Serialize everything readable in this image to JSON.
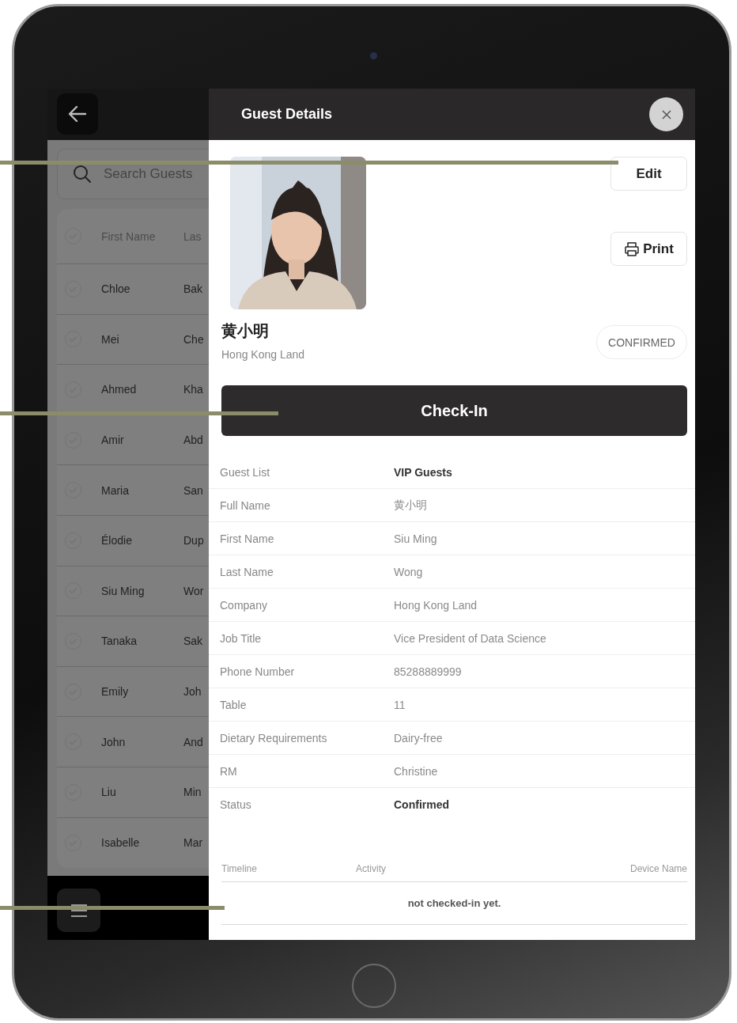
{
  "sidebar": {
    "search": {
      "placeholder": "Search Guests"
    },
    "table": {
      "header": {
        "checked": false,
        "columns": [
          "First Name",
          "Las"
        ]
      },
      "rows": [
        {
          "checked": false,
          "cells": [
            "Chloe",
            "Bak"
          ]
        },
        {
          "checked": false,
          "cells": [
            "Mei",
            "Che"
          ]
        },
        {
          "checked": false,
          "cells": [
            "Ahmed",
            "Kha"
          ]
        },
        {
          "checked": false,
          "cells": [
            "Amir",
            "Abd"
          ]
        },
        {
          "checked": false,
          "cells": [
            "Maria",
            "San"
          ]
        },
        {
          "checked": false,
          "cells": [
            "Élodie",
            "Dup"
          ]
        },
        {
          "checked": false,
          "cells": [
            "Siu Ming",
            "Wor"
          ]
        },
        {
          "checked": false,
          "cells": [
            "Tanaka",
            "Sak"
          ]
        },
        {
          "checked": false,
          "cells": [
            "Emily",
            "Joh"
          ]
        },
        {
          "checked": false,
          "cells": [
            "John",
            "And"
          ]
        },
        {
          "checked": false,
          "cells": [
            "Liu",
            "Min"
          ]
        },
        {
          "checked": false,
          "cells": [
            "Isabelle",
            "Mar"
          ]
        }
      ]
    }
  },
  "panel": {
    "title": "Guest Details",
    "guest": {
      "name": "黄小明",
      "company": "Hong Kong Land",
      "status": "CONFIRMED"
    },
    "buttons": {
      "edit": "Edit",
      "print": "Print",
      "check_in": "Check-In"
    },
    "details": [
      {
        "label": "Guest List",
        "value": "VIP Guests",
        "emphasis": true
      },
      {
        "label": "Full Name",
        "value": "黄小明",
        "emphasis": false
      },
      {
        "label": "First Name",
        "value": "Siu Ming",
        "emphasis": false
      },
      {
        "label": "Last Name",
        "value": "Wong",
        "emphasis": false
      },
      {
        "label": "Company",
        "value": "Hong Kong Land",
        "emphasis": false
      },
      {
        "label": "Job Title",
        "value": "Vice President of Data Science",
        "emphasis": false
      },
      {
        "label": "Phone Number",
        "value": "85288889999",
        "emphasis": false
      },
      {
        "label": "Table",
        "value": "11",
        "emphasis": false
      },
      {
        "label": "Dietary Requirements",
        "value": "Dairy-free",
        "emphasis": false
      },
      {
        "label": "RM",
        "value": "Christine",
        "emphasis": false
      },
      {
        "label": "Status",
        "value": "Confirmed",
        "emphasis": true
      }
    ],
    "timeline": {
      "columns": [
        "Timeline",
        "Activity",
        "Device Name"
      ],
      "empty": "not checked-in yet."
    }
  }
}
